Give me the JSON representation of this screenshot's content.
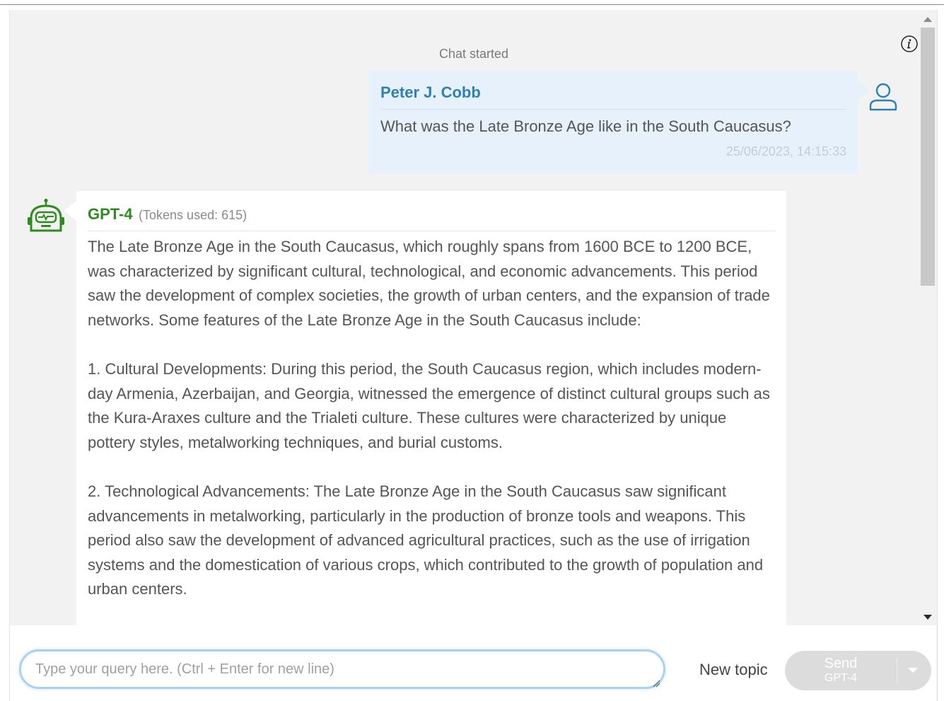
{
  "chat": {
    "started_label": "Chat started"
  },
  "user_message": {
    "author": "Peter J. Cobb",
    "text": "What was the Late Bronze Age like in the South Caucasus?",
    "timestamp": "25/06/2023, 14:15:33"
  },
  "bot_message": {
    "model": "GPT-4",
    "tokens": "(Tokens used: 615)",
    "paragraphs": [
      "The Late Bronze Age in the South Caucasus, which roughly spans from 1600 BCE to 1200 BCE, was characterized by significant cultural, technological, and economic advancements. This period saw the development of complex societies, the growth of urban centers, and the expansion of trade networks. Some features of the Late Bronze Age in the South Caucasus include:",
      "1. Cultural Developments: During this period, the South Caucasus region, which includes modern-day Armenia, Azerbaijan, and Georgia, witnessed the emergence of distinct cultural groups such as the Kura-Araxes culture and the Trialeti culture. These cultures were characterized by unique pottery styles, metalworking techniques, and burial customs.",
      "2. Technological Advancements: The Late Bronze Age in the South Caucasus saw significant advancements in metalworking, particularly in the production of bronze tools and weapons. This period also saw the development of advanced agricultural practices, such as the use of irrigation systems and the domestication of various crops, which contributed to the growth of population and urban centers."
    ]
  },
  "composer": {
    "placeholder": "Type your query here. (Ctrl + Enter for new line)",
    "value": "",
    "new_topic_label": "New topic",
    "send_label": "Send",
    "send_model": "GPT-4"
  },
  "icons": {
    "info": "info-icon",
    "user": "user-avatar-icon",
    "bot": "robot-icon",
    "dropdown": "caret-down-icon"
  },
  "colors": {
    "user_name": "#2f7fb6",
    "bot_name": "#2e8b1f",
    "user_bubble": "#e7f1fb",
    "input_border": "#a9d0f5",
    "send_disabled": "#dcdcdc"
  }
}
